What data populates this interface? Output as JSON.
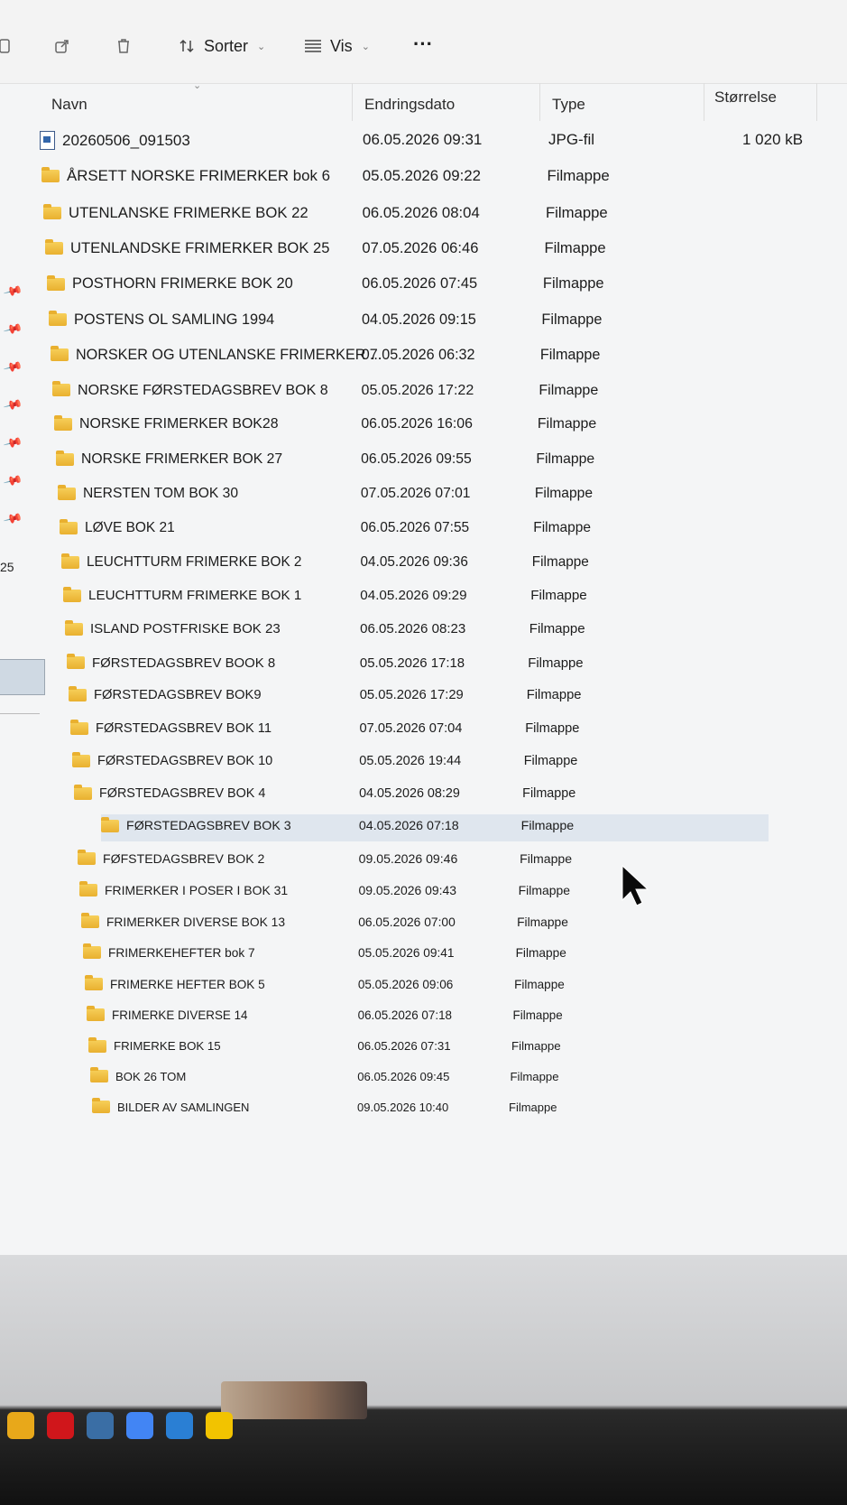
{
  "toolbar": {
    "sort_label": "Sorter",
    "view_label": "Vis",
    "more_label": "···"
  },
  "columns": {
    "name": "Navn",
    "date": "Endringsdato",
    "type": "Type",
    "size": "Størrelse"
  },
  "left_pane": {
    "number": "25"
  },
  "files": [
    {
      "name": "20260506_091503",
      "date": "06.05.2026 09:31",
      "type": "JPG-fil",
      "size": "1 020 kB",
      "icon": "image-file-icon"
    },
    {
      "name": "ÅRSETT NORSKE FRIMERKER bok 6",
      "date": "05.05.2026 09:22",
      "type": "Filmappe",
      "size": "",
      "icon": "folder-icon"
    },
    {
      "name": "UTENLANSKE FRIMERKE BOK 22",
      "date": "06.05.2026 08:04",
      "type": "Filmappe",
      "size": "",
      "icon": "folder-icon"
    },
    {
      "name": "UTENLANDSKE FRIMERKER BOK 25",
      "date": "07.05.2026 06:46",
      "type": "Filmappe",
      "size": "",
      "icon": "folder-icon"
    },
    {
      "name": "POSTHORN FRIMERKE BOK 20",
      "date": "06.05.2026 07:45",
      "type": "Filmappe",
      "size": "",
      "icon": "folder-icon"
    },
    {
      "name": "POSTENS OL SAMLING 1994",
      "date": "04.05.2026 09:15",
      "type": "Filmappe",
      "size": "",
      "icon": "folder-icon"
    },
    {
      "name": "NORSKER OG UTENLANSKE FRIMERKER ...",
      "date": "07.05.2026 06:32",
      "type": "Filmappe",
      "size": "",
      "icon": "folder-icon"
    },
    {
      "name": "NORSKE FØRSTEDAGSBREV BOK 8",
      "date": "05.05.2026 17:22",
      "type": "Filmappe",
      "size": "",
      "icon": "folder-icon"
    },
    {
      "name": "NORSKE FRIMERKER BOK28",
      "date": "06.05.2026 16:06",
      "type": "Filmappe",
      "size": "",
      "icon": "folder-icon"
    },
    {
      "name": "NORSKE FRIMERKER BOK 27",
      "date": "06.05.2026 09:55",
      "type": "Filmappe",
      "size": "",
      "icon": "folder-icon"
    },
    {
      "name": "NERSTEN TOM BOK 30",
      "date": "07.05.2026 07:01",
      "type": "Filmappe",
      "size": "",
      "icon": "folder-icon"
    },
    {
      "name": "LØVE BOK 21",
      "date": "06.05.2026 07:55",
      "type": "Filmappe",
      "size": "",
      "icon": "folder-icon"
    },
    {
      "name": "LEUCHTTURM FRIMERKE BOK 2",
      "date": "04.05.2026 09:36",
      "type": "Filmappe",
      "size": "",
      "icon": "folder-icon"
    },
    {
      "name": "LEUCHTTURM FRIMERKE BOK 1",
      "date": "04.05.2026 09:29",
      "type": "Filmappe",
      "size": "",
      "icon": "folder-icon"
    },
    {
      "name": "ISLAND POSTFRISKE BOK 23",
      "date": "06.05.2026 08:23",
      "type": "Filmappe",
      "size": "",
      "icon": "folder-icon"
    },
    {
      "name": "FØRSTEDAGSBREV BOOK 8",
      "date": "05.05.2026 17:18",
      "type": "Filmappe",
      "size": "",
      "icon": "folder-icon"
    },
    {
      "name": "FØRSTEDAGSBREV BOK9",
      "date": "05.05.2026 17:29",
      "type": "Filmappe",
      "size": "",
      "icon": "folder-icon"
    },
    {
      "name": "FØRSTEDAGSBREV BOK 11",
      "date": "07.05.2026 07:04",
      "type": "Filmappe",
      "size": "",
      "icon": "folder-icon"
    },
    {
      "name": "FØRSTEDAGSBREV BOK 10",
      "date": "05.05.2026 19:44",
      "type": "Filmappe",
      "size": "",
      "icon": "folder-icon"
    },
    {
      "name": "FØRSTEDAGSBREV BOK 4",
      "date": "04.05.2026 08:29",
      "type": "Filmappe",
      "size": "",
      "icon": "folder-icon"
    },
    {
      "name": "FØRSTEDAGSBREV BOK 3",
      "date": "04.05.2026 07:18",
      "type": "Filmappe",
      "size": "",
      "icon": "folder-icon",
      "selected": true
    },
    {
      "name": "FØFSTEDAGSBREV BOK 2",
      "date": "09.05.2026 09:46",
      "type": "Filmappe",
      "size": "",
      "icon": "folder-icon"
    },
    {
      "name": "FRIMERKER I POSER I BOK 31",
      "date": "09.05.2026 09:43",
      "type": "Filmappe",
      "size": "",
      "icon": "folder-icon"
    },
    {
      "name": "FRIMERKER DIVERSE BOK 13",
      "date": "06.05.2026 07:00",
      "type": "Filmappe",
      "size": "",
      "icon": "folder-icon"
    },
    {
      "name": "FRIMERKEHEFTER bok 7",
      "date": "05.05.2026 09:41",
      "type": "Filmappe",
      "size": "",
      "icon": "folder-icon"
    },
    {
      "name": "FRIMERKE HEFTER BOK 5",
      "date": "05.05.2026 09:06",
      "type": "Filmappe",
      "size": "",
      "icon": "folder-icon"
    },
    {
      "name": "FRIMERKE DIVERSE 14",
      "date": "06.05.2026 07:18",
      "type": "Filmappe",
      "size": "",
      "icon": "folder-icon"
    },
    {
      "name": "FRIMERKE BOK 15",
      "date": "06.05.2026 07:31",
      "type": "Filmappe",
      "size": "",
      "icon": "folder-icon"
    },
    {
      "name": "BOK 26 TOM",
      "date": "06.05.2026 09:45",
      "type": "Filmappe",
      "size": "",
      "icon": "folder-icon"
    },
    {
      "name": "BILDER AV SAMLINGEN",
      "date": "09.05.2026 10:40",
      "type": "Filmappe",
      "size": "",
      "icon": "folder-icon"
    }
  ],
  "taskbar": [
    {
      "icon": "file-explorer-icon",
      "color": "#e8a81a"
    },
    {
      "icon": "opera-icon",
      "color": "#d0161b"
    },
    {
      "icon": "app-icon",
      "color": "#3a6ea5"
    },
    {
      "icon": "chrome-icon",
      "color": "#4285f4"
    },
    {
      "icon": "network-icon",
      "color": "#2a7fd4"
    },
    {
      "icon": "norton-icon",
      "color": "#f2c300"
    }
  ]
}
